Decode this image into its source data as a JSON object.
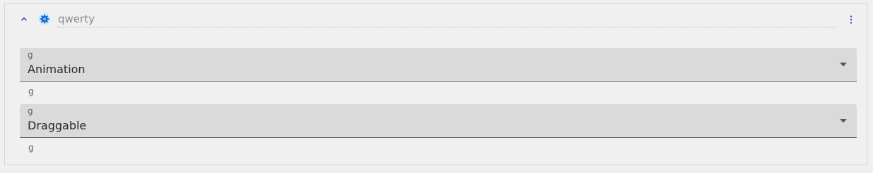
{
  "header": {
    "collapse_icon": "chevron-up-icon",
    "node_icon": "blue-gear-icon",
    "name_value": "qwerty",
    "more_icon": "vertical-dots-icon"
  },
  "fields": [
    {
      "label": "g",
      "value": "Animation",
      "helper": "g",
      "dropdown_icon": "caret-down-icon"
    },
    {
      "label": "g",
      "value": "Draggable",
      "helper": "g",
      "dropdown_icon": "caret-down-icon"
    }
  ],
  "colors": {
    "accent": "#3f51b5",
    "icon_blue": "#1e88e5",
    "field_bg": "#dadada",
    "panel_bg": "#f0f0f0"
  }
}
